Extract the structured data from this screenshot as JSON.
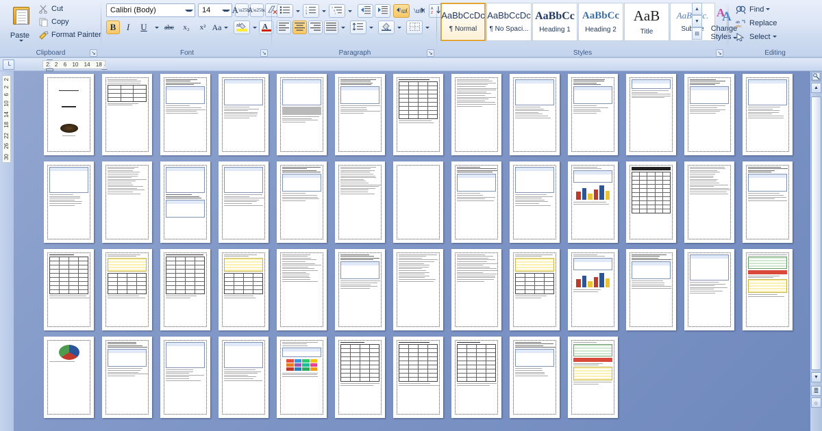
{
  "ribbon": {
    "clipboard": {
      "label": "Clipboard",
      "paste": "Paste",
      "cut": "Cut",
      "copy": "Copy",
      "format_painter": "Format Painter",
      "dialog_launcher": "↘"
    },
    "font": {
      "label": "Font",
      "font_name": "Calibri (Body)",
      "font_size": "14",
      "grow_font": "A",
      "shrink_font": "A",
      "clear_formatting": "clear-formatting-icon",
      "bold": "B",
      "italic": "I",
      "underline": "U",
      "strikethrough": "abc",
      "subscript": "x₂",
      "superscript": "x²",
      "change_case": "Aa",
      "highlight": "ab",
      "font_color": "A",
      "dialog_launcher": "↘",
      "bold_active": true
    },
    "paragraph": {
      "label": "Paragraph",
      "bullets": "bullets-icon",
      "numbering": "numbering-icon",
      "multilevel": "multilevel-list-icon",
      "decrease_indent": "decrease-indent-icon",
      "increase_indent": "increase-indent-icon",
      "ltr": "left-to-right-icon",
      "rtl": "right-to-left-icon",
      "sort": "sort-icon",
      "show_marks": "¶",
      "align_left": "align-left-icon",
      "align_center": "align-center-icon",
      "align_right": "align-right-icon",
      "justify": "justify-icon",
      "line_spacing": "line-spacing-icon",
      "shading": "shading-icon",
      "borders": "borders-icon",
      "dialog_launcher": "↘",
      "ltr_active": true,
      "align_center_active": true
    },
    "styles": {
      "label": "Styles",
      "dialog_launcher": "↘",
      "change_styles": "Change\nStyles",
      "change_styles_line1": "Change",
      "change_styles_line2": "Styles",
      "scroll_up": "▲",
      "scroll_down": "▼",
      "more": "▤",
      "gallery": [
        {
          "preview": "AaBbCcDc",
          "name": "¶ Normal",
          "selected": true
        },
        {
          "preview": "AaBbCcDc",
          "name": "¶ No Spaci...",
          "selected": false
        },
        {
          "preview": "AaBbCс",
          "name": "Heading 1",
          "selected": false
        },
        {
          "preview": "AaBbCc",
          "name": "Heading 2",
          "selected": false
        },
        {
          "preview": "AaВ",
          "name": "Title",
          "selected": false
        },
        {
          "preview": "AaBbCc.",
          "name": "Subtitle",
          "selected": false
        }
      ]
    },
    "editing": {
      "label": "Editing",
      "find": "Find",
      "replace": "Replace",
      "select": "Select"
    }
  },
  "rulers": {
    "tab_selector": "└",
    "horizontal_ticks": [
      "2",
      "2",
      "6",
      "10",
      "14",
      "18"
    ],
    "vertical_ticks": [
      "2",
      "2",
      "6",
      "10",
      "14",
      "18",
      "22",
      "26",
      "30"
    ]
  },
  "scrollbar": {
    "browse_object": "select-browse-object-icon",
    "up_arrow": "▲",
    "down_arrow": "▼",
    "previous_page": "≣",
    "next_page": "○"
  },
  "document": {
    "view": "multiple-pages",
    "total_visible_pages": 49,
    "rows": [
      13,
      13,
      13,
      10
    ],
    "pages": [
      {
        "n": 1,
        "kind": "title"
      },
      {
        "n": 2,
        "kind": "table-form"
      },
      {
        "n": 3,
        "kind": "text-shot"
      },
      {
        "n": 4,
        "kind": "shot-text"
      },
      {
        "n": 5,
        "kind": "shot-gray"
      },
      {
        "n": 6,
        "kind": "text-shot"
      },
      {
        "n": 7,
        "kind": "table-dense"
      },
      {
        "n": 8,
        "kind": "text-only"
      },
      {
        "n": 9,
        "kind": "shot-text"
      },
      {
        "n": 10,
        "kind": "text-shot"
      },
      {
        "n": 11,
        "kind": "text-top"
      },
      {
        "n": 12,
        "kind": "text-shot"
      },
      {
        "n": 13,
        "kind": "shot-text"
      },
      {
        "n": 14,
        "kind": "shot-text"
      },
      {
        "n": 15,
        "kind": "text-only"
      },
      {
        "n": 16,
        "kind": "shot-tall"
      },
      {
        "n": 17,
        "kind": "shot-text"
      },
      {
        "n": 18,
        "kind": "text-shot"
      },
      {
        "n": 19,
        "kind": "text-only"
      },
      {
        "n": 20,
        "kind": "blank"
      },
      {
        "n": 21,
        "kind": "text-shot"
      },
      {
        "n": 22,
        "kind": "shot-text"
      },
      {
        "n": 23,
        "kind": "chart-bars"
      },
      {
        "n": 24,
        "kind": "table-dark"
      },
      {
        "n": 25,
        "kind": "text-only"
      },
      {
        "n": 26,
        "kind": "text-shot"
      },
      {
        "n": 27,
        "kind": "table-dense"
      },
      {
        "n": 28,
        "kind": "table-color"
      },
      {
        "n": 29,
        "kind": "table-dense"
      },
      {
        "n": 30,
        "kind": "table-color"
      },
      {
        "n": 31,
        "kind": "text-only"
      },
      {
        "n": 32,
        "kind": "text-shot"
      },
      {
        "n": 33,
        "kind": "text-only"
      },
      {
        "n": 34,
        "kind": "text-only"
      },
      {
        "n": 35,
        "kind": "table-color"
      },
      {
        "n": 36,
        "kind": "chart-bars"
      },
      {
        "n": 37,
        "kind": "text-shot"
      },
      {
        "n": 38,
        "kind": "shot-text"
      },
      {
        "n": 39,
        "kind": "grid-sheets"
      },
      {
        "n": 40,
        "kind": "chart-pie"
      },
      {
        "n": 41,
        "kind": "text-shot"
      },
      {
        "n": 42,
        "kind": "shot-text"
      },
      {
        "n": 43,
        "kind": "shot-text"
      },
      {
        "n": 44,
        "kind": "color-swatches"
      },
      {
        "n": 45,
        "kind": "table-dense"
      },
      {
        "n": 46,
        "kind": "table-dense"
      },
      {
        "n": 47,
        "kind": "table-dense"
      },
      {
        "n": 48,
        "kind": "text-shot"
      },
      {
        "n": 49,
        "kind": "grid-sheets"
      }
    ]
  },
  "colors": {
    "ribbon_bg": "#dbe5f5",
    "canvas_bg": "#8097c7",
    "accent_gold": "#f7c765",
    "text_blue": "#1d3557",
    "page_white": "#ffffff"
  }
}
